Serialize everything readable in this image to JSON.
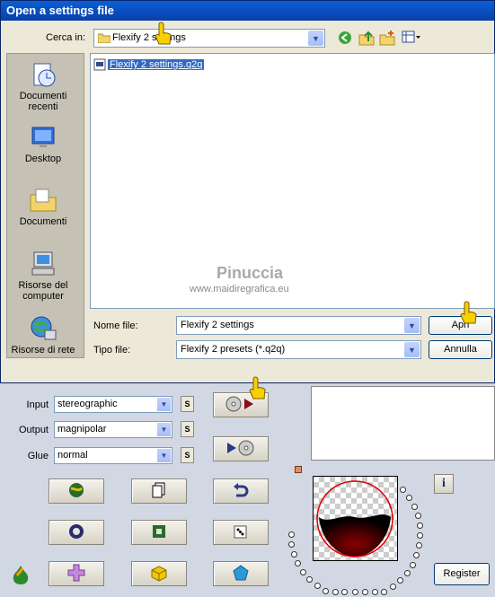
{
  "dialog": {
    "title": "Open a settings file",
    "look_in_label": "Cerca in:",
    "look_in_value": "Flexify 2 settings",
    "files": [
      "Flexify 2 settings.q2q"
    ],
    "places": [
      {
        "label": "Documenti recenti",
        "icon": "recent-documents-icon"
      },
      {
        "label": "Desktop",
        "icon": "desktop-icon"
      },
      {
        "label": "Documenti",
        "icon": "documents-folder-icon"
      },
      {
        "label": "Risorse del computer",
        "icon": "my-computer-icon"
      },
      {
        "label": "Risorse di rete",
        "icon": "network-icon"
      }
    ],
    "filename_label": "Nome file:",
    "filename_value": "Flexify 2 settings",
    "filetype_label": "Tipo file:",
    "filetype_value": "Flexify 2 presets (*.q2q)",
    "open_button": "Apri",
    "cancel_button": "Annulla",
    "watermark_line1": "Pinuccia",
    "watermark_line2": "www.maidiregrafica.eu"
  },
  "panel": {
    "input_label": "Input",
    "input_value": "stereographic",
    "output_label": "Output",
    "output_value": "magnipolar",
    "glue_label": "Glue",
    "glue_value": "normal",
    "s_label": "S",
    "info_label": "i",
    "register_button": "Register"
  }
}
